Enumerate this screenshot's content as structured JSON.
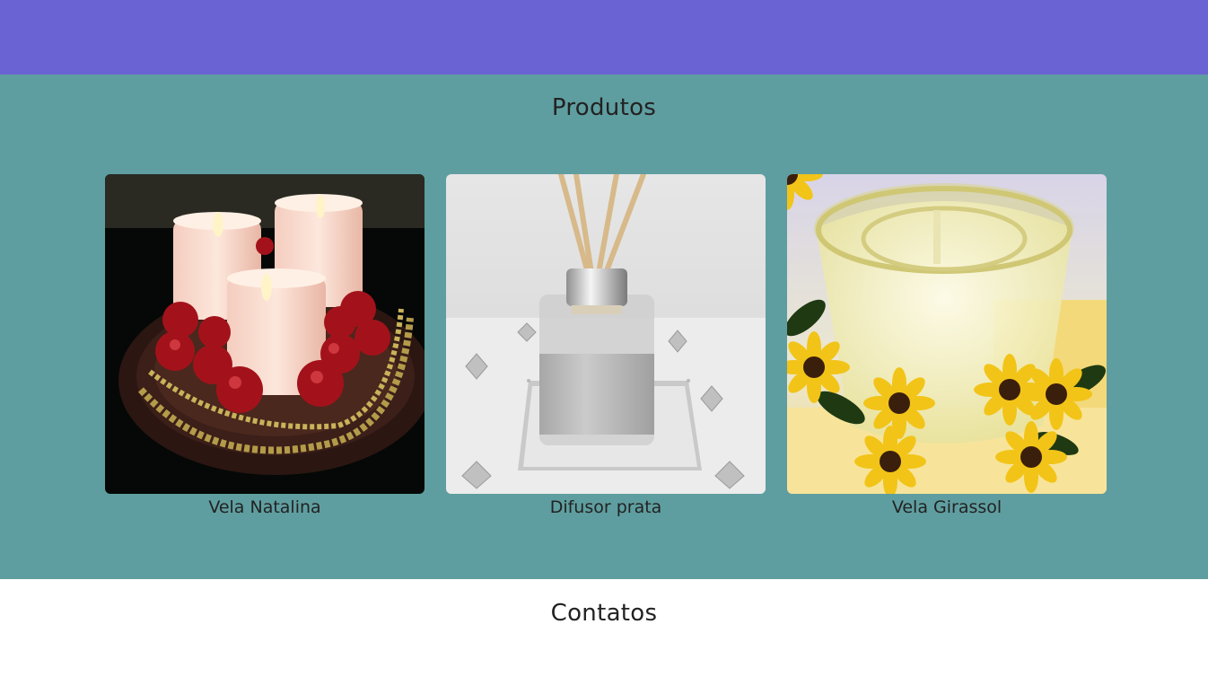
{
  "header": {
    "color": "#6a63d4"
  },
  "products": {
    "title": "Produtos",
    "background": "#5f9ea0",
    "items": [
      {
        "label": "Vela Natalina",
        "image": "christmas-candles-image"
      },
      {
        "label": "Difusor prata",
        "image": "silver-diffuser-image"
      },
      {
        "label": "Vela Girassol",
        "image": "sunflower-candle-image"
      }
    ]
  },
  "contacts": {
    "title": "Contatos"
  }
}
